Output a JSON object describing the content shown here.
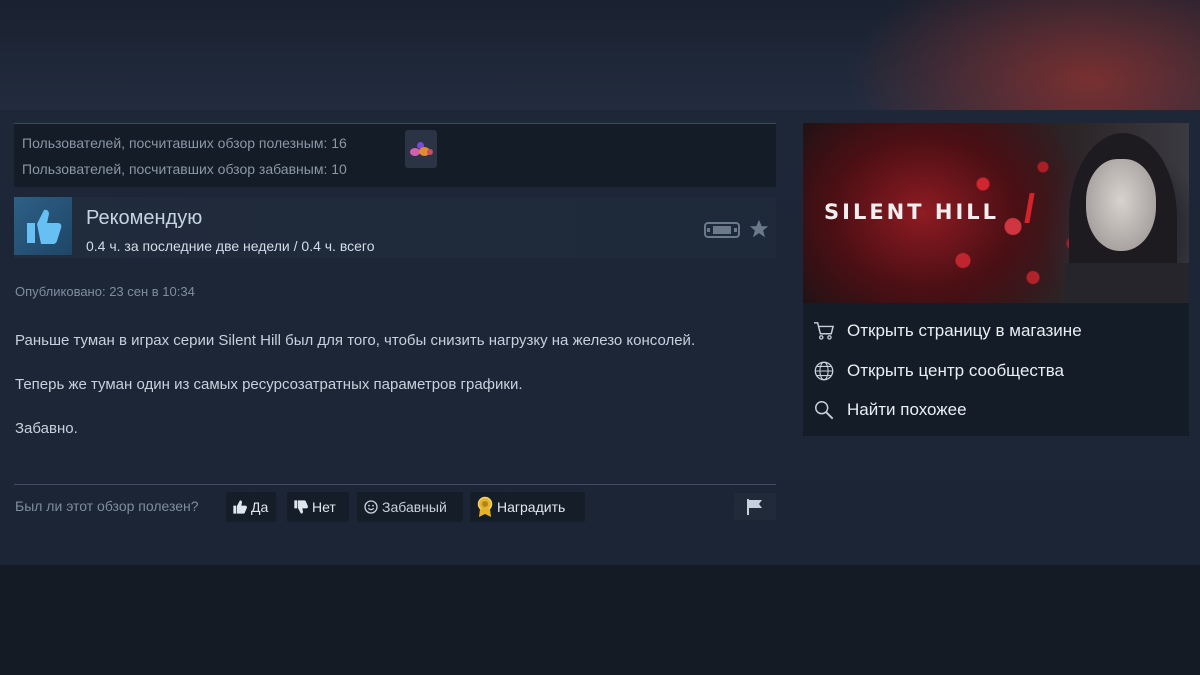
{
  "votes": {
    "helpful_text": "Пользователей, посчитавших обзор полезным: 16",
    "funny_text": "Пользователей, посчитавших обзор забавным: 10"
  },
  "review": {
    "recommendation": "Рекомендую",
    "hours": "0.4 ч. за последние две недели / 0.4 ч. всего",
    "published": "Опубликовано: 23 сен в 10:34",
    "paragraphs": [
      "Раньше туман в играх серии Silent Hill был для того, чтобы снизить нагрузку на железо консолей.",
      "Теперь же туман один из самых ресурсозатратных параметров графики.",
      "Забавно."
    ]
  },
  "helpful_prompt": {
    "question": "Был ли этот обзор полезен?",
    "yes": "Да",
    "no": "Нет",
    "funny": "Забавный",
    "award": "Наградить"
  },
  "game": {
    "logo_text": "SILENT HILL",
    "links": {
      "store": "Открыть страницу в магазине",
      "community": "Открыть центр сообщества",
      "similar": "Найти похожее"
    }
  },
  "icons": {
    "thumb": "thumbs-up-icon",
    "steamdeck": "steam-deck-icon",
    "star": "star-icon",
    "cart": "cart-icon",
    "globe": "globe-icon",
    "search": "search-icon",
    "flag": "flag-icon",
    "award": "award-icon"
  },
  "colors": {
    "accent_blue": "#2e5f86",
    "logo_red": "#d3232b",
    "text_light": "#c7d1dc"
  }
}
